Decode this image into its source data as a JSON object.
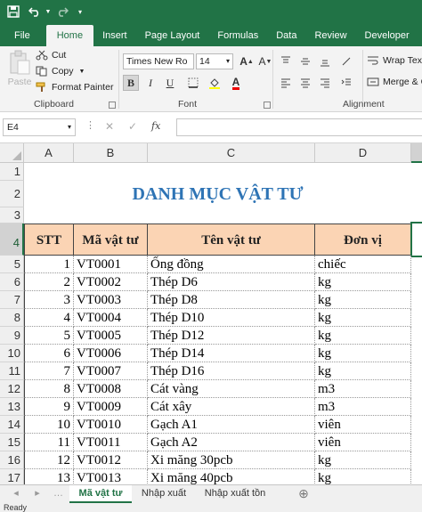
{
  "quick_access": {
    "save_icon": "save-icon",
    "undo_icon": "undo-icon",
    "redo_icon": "redo-icon",
    "customize_icon": "customize-qat-icon"
  },
  "ribbon_tabs": [
    "File",
    "Home",
    "Insert",
    "Page Layout",
    "Formulas",
    "Data",
    "Review",
    "Developer"
  ],
  "ribbon": {
    "clipboard": {
      "paste": "Paste",
      "cut": "Cut",
      "copy": "Copy",
      "format_painter": "Format Painter",
      "label": "Clipboard"
    },
    "font": {
      "name": "Times New Ro",
      "size": "14",
      "bold": "B",
      "italic": "I",
      "underline": "U",
      "label": "Font"
    },
    "alignment": {
      "wrap": "Wrap Text",
      "merge": "Merge & C",
      "label": "Alignment"
    }
  },
  "formula_bar": {
    "name_box": "E4",
    "fx": "fx",
    "value": ""
  },
  "columns": [
    "A",
    "B",
    "C",
    "D"
  ],
  "rows": [
    "1",
    "2",
    "3",
    "4",
    "5",
    "6",
    "7",
    "8",
    "9",
    "10",
    "11",
    "12",
    "13",
    "14",
    "15",
    "16",
    "17"
  ],
  "sheet": {
    "title": "DANH MỤC VẬT TƯ",
    "headers": [
      "STT",
      "Mã vật tư",
      "Tên vật tư",
      "Đơn vị"
    ],
    "data": [
      [
        "1",
        "VT0001",
        "Ống đồng",
        "chiếc"
      ],
      [
        "2",
        "VT0002",
        "Thép D6",
        "kg"
      ],
      [
        "3",
        "VT0003",
        "Thép D8",
        "kg"
      ],
      [
        "4",
        "VT0004",
        "Thép D10",
        "kg"
      ],
      [
        "5",
        "VT0005",
        "Thép D12",
        "kg"
      ],
      [
        "6",
        "VT0006",
        "Thép D14",
        "kg"
      ],
      [
        "7",
        "VT0007",
        "Thép D16",
        "kg"
      ],
      [
        "8",
        "VT0008",
        "Cát vàng",
        "m3"
      ],
      [
        "9",
        "VT0009",
        "Cát xây",
        "m3"
      ],
      [
        "10",
        "VT0010",
        "Gạch A1",
        "viên"
      ],
      [
        "11",
        "VT0011",
        "Gạch A2",
        "viên"
      ],
      [
        "12",
        "VT0012",
        "Xi măng 30pcb",
        "kg"
      ],
      [
        "13",
        "VT0013",
        "Xi măng 40pcb",
        "kg"
      ]
    ]
  },
  "sheet_tabs": [
    "Mã vật tư",
    "Nhập xuất",
    "Nhập xuất tồn"
  ],
  "status_text": "Ready",
  "colors": {
    "accent": "#217346",
    "header_fill": "#fbd4b4",
    "title_color": "#2e74b5"
  }
}
